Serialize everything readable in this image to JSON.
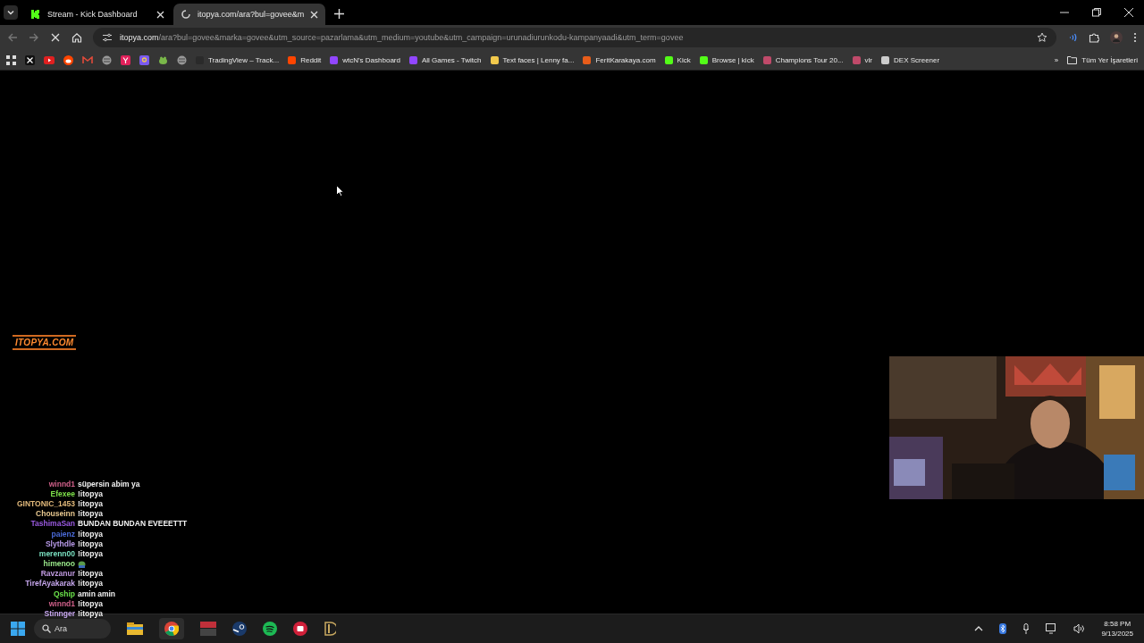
{
  "tabs": [
    {
      "title": "Stream - Kick Dashboard",
      "selected": false,
      "kind": "kick"
    },
    {
      "title": "itopya.com/ara?bul=govee&m",
      "selected": true,
      "kind": "loading"
    }
  ],
  "address": {
    "host": "itopya.com",
    "path": "/ara?bul=govee&marka=govee&utm_source=pazarlama&utm_medium=youtube&utm_campaign=urunadiurunkodu-kampanyaadi&utm_term=govee"
  },
  "bookmarks": [
    "TradingView – Track...",
    "Reddit",
    "wtcN's Dashboard",
    "All Games - Twitch",
    "Text faces | Lenny fa...",
    "FeritKarakaya.com",
    "Kick",
    "Browse | kick",
    "Champions Tour 20...",
    "vlr",
    "DEX Screener"
  ],
  "bookmarks_more": "»",
  "all_bookmarks": "Tüm Yer İşaretleri",
  "overlay_logo": "ITOPYA.COM",
  "chat": [
    {
      "name": "winnd1",
      "color": "#d0608a",
      "message": "süpersin abim ya",
      "kind": "text"
    },
    {
      "name": "Efexee",
      "color": "#7ee04a",
      "message": "!itopya",
      "kind": "text"
    },
    {
      "name": "GINTONIC_1453",
      "color": "#e0b87a",
      "message": "!itopya",
      "kind": "text"
    },
    {
      "name": "Chouseinn",
      "color": "#e8c890",
      "message": "!itopya",
      "kind": "text"
    },
    {
      "name": "TashimaSan",
      "color": "#9a5ae0",
      "message": "BUNDAN BUNDAN EVEEETTT",
      "kind": "text"
    },
    {
      "name": "paienz",
      "color": "#4a6ad8",
      "message": "!itopya",
      "kind": "text"
    },
    {
      "name": "Slythdle",
      "color": "#b89ae8",
      "message": "!itopya",
      "kind": "text"
    },
    {
      "name": "merenn00",
      "color": "#7ae0c0",
      "message": "!itopya",
      "kind": "text"
    },
    {
      "name": "himenoo",
      "color": "#9ae88a",
      "kind": "emote"
    },
    {
      "name": "Ravzanur",
      "color": "#c09ae0",
      "message": "!itopya",
      "kind": "text"
    },
    {
      "name": "TirefAyakarak",
      "color": "#c8a8f0",
      "message": "!itopya",
      "kind": "text"
    },
    {
      "name": "Qship",
      "color": "#6ae04a",
      "message": "amin amin",
      "kind": "text"
    },
    {
      "name": "winnd1",
      "color": "#d0608a",
      "message": "!itopya",
      "kind": "text"
    },
    {
      "name": "Stinnger",
      "color": "#c8a8f0",
      "message": "!itopya",
      "kind": "text"
    }
  ],
  "taskbar": {
    "search_placeholder": "Ara",
    "time": "8:58 PM",
    "date": "9/13/2025"
  }
}
